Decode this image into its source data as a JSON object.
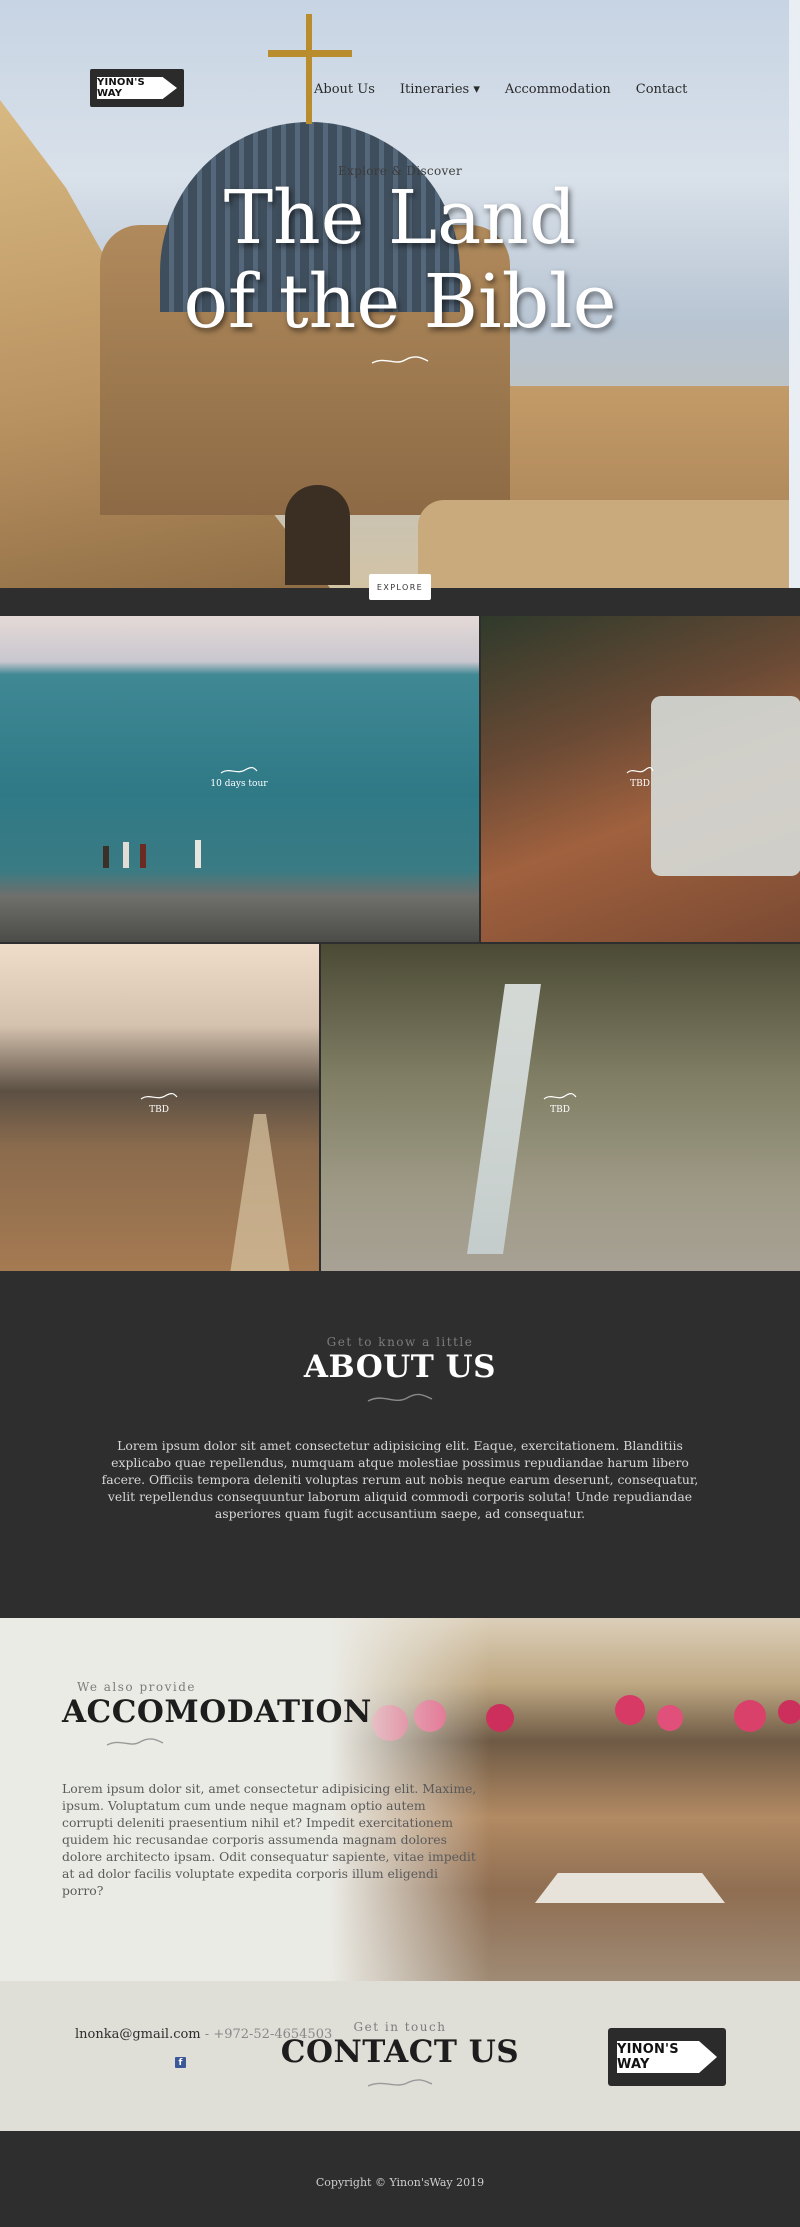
{
  "brand": {
    "logo_text": "YINON'S WAY"
  },
  "nav": {
    "items": [
      {
        "label": "About Us"
      },
      {
        "label": "Itineraries ▾"
      },
      {
        "label": "Accommodation"
      },
      {
        "label": "Contact"
      }
    ]
  },
  "hero": {
    "tagline": "Explore & Discover",
    "title_line1": "The Land",
    "title_line2": "of the Bible",
    "explore_label": "EXPLORE"
  },
  "gallery": {
    "tiles": [
      {
        "label": "10 days tour"
      },
      {
        "label": "TBD"
      },
      {
        "label": "TBD"
      },
      {
        "label": "TBD"
      }
    ]
  },
  "about": {
    "eyebrow": "Get to know a little",
    "title": "ABOUT US",
    "text": "Lorem ipsum dolor sit amet consectetur adipisicing elit. Eaque, exercitationem. Blanditiis explicabo quae repellendus, numquam atque molestiae possimus repudiandae harum libero facere. Officiis tempora deleniti voluptas rerum aut nobis neque earum deserunt, consequatur, velit repellendus consequuntur laborum aliquid commodi corporis soluta! Unde repudiandae asperiores quam fugit accusantium saepe, ad consequatur."
  },
  "accommodation": {
    "eyebrow": "We also provide",
    "title": "ACCOMODATION",
    "text": "Lorem ipsum dolor sit, amet consectetur adipisicing elit. Maxime, ipsum. Voluptatum cum unde neque magnam optio autem corrupti deleniti praesentium nihil et? Impedit exercitationem quidem hic recusandae corporis assumenda magnam dolores dolore architecto ipsam. Odit consequatur sapiente, vitae impedit at ad dolor facilis voluptate expedita corporis illum eligendi porro?"
  },
  "contact": {
    "email": "lnonka@gmail.com",
    "separator": " - ",
    "phone": "+972-52-4654503",
    "eyebrow": "Get in touch",
    "title": "CONTACT US",
    "facebook_icon": "facebook-icon"
  },
  "footer": {
    "copyright": "Copyright © Yinon'sWay 2019"
  }
}
